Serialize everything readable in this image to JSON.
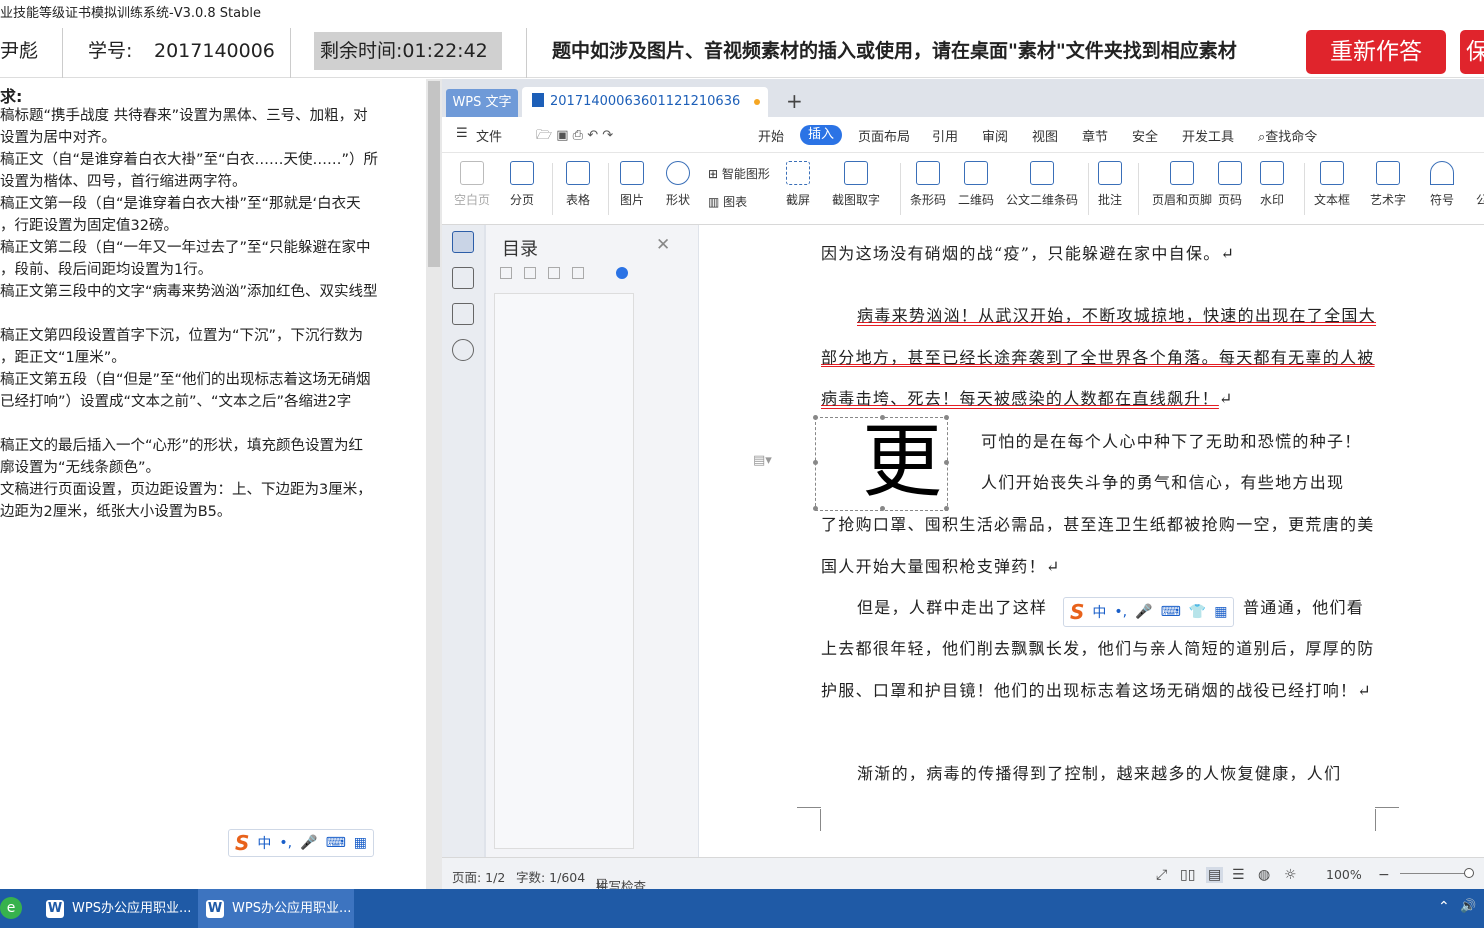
{
  "window": {
    "title": "业技能等级证书模拟训练系统-V3.0.8 Stable"
  },
  "header": {
    "name_fragment": "尹彪",
    "student_id_label": "学号:",
    "student_id": "2017140006",
    "timer_label": "剩余时间:",
    "timer_value": "01:22:42",
    "notice": "题中如涉及图片、音视频素材的插入或使用，请在桌面\"素材\"文件夹找到相应素材",
    "redo_button": "重新作答",
    "save_button_fragment": "保"
  },
  "requirements": {
    "title": "求:",
    "lines": [
      "稿标题“携手战度 共待春来”设置为黑体、三号、加粗，对",
      "设置为居中对齐。",
      "稿正文（自“是谁穿着白衣大褂”至“白衣……天使……”）所",
      "设置为楷体、四号，首行缩进两字符。",
      "稿正文第一段（自“是谁穿着白衣大褂”至“那就是‘白衣天",
      "，行距设置为固定值32磅。",
      "稿正文第二段（自“一年又一年过去了”至“只能躲避在家中",
      "，段前、段后间距均设置为1行。",
      "稿正文第三段中的文字“病毒来势汹汹”添加红色、双实线型",
      "",
      "稿正文第四段设置首字下沉，位置为“下沉”，下沉行数为",
      "，距正文“1厘米”。",
      "稿正文第五段（自“但是”至“他们的出现标志着这场无硝烟",
      "已经打响”）设置成“文本之前”、“文本之后”各缩进2字",
      "",
      "稿正文的最后插入一个“心形”的形状，填充颜色设置为红",
      "廓设置为“无线条颜色”。",
      "文稿进行页面设置，页边距设置为：上、下边距为3厘米，",
      "边距为2厘米，纸张大小设置为B5。"
    ]
  },
  "ime": {
    "zh": "中",
    "punct": "•,"
  },
  "wps": {
    "tab_app": "WPS 文字",
    "tab_doc": "20171400063601121210636",
    "menus": [
      "文件",
      "开始",
      "插入",
      "页面布局",
      "引用",
      "审阅",
      "视图",
      "章节",
      "安全",
      "开发工具",
      "查找命令"
    ],
    "active_menu": "插入",
    "ribbon": [
      {
        "label": "空白页",
        "disabled": true
      },
      {
        "label": "分页"
      },
      {
        "label": "表格"
      },
      {
        "label": "图片"
      },
      {
        "label": "形状"
      },
      {
        "label": "截屏"
      },
      {
        "label": "截图取字"
      },
      {
        "label": "条形码"
      },
      {
        "label": "二维码"
      },
      {
        "label": "公文二维条码"
      },
      {
        "label": "批注"
      },
      {
        "label": "页眉和页脚"
      },
      {
        "label": "页码"
      },
      {
        "label": "水印"
      },
      {
        "label": "文本框"
      },
      {
        "label": "艺术字"
      },
      {
        "label": "符号"
      },
      {
        "label": "公"
      }
    ],
    "ribbon_small": {
      "smart_shape": "智能图形",
      "chart": "图表"
    },
    "toc_title": "目录",
    "document": {
      "p0": "因为这场没有硝烟的战“疫”，只能躲避在家中自保。↵",
      "p1": "病毒来势汹汹！从武汉开始，不断攻城掠地，快速的出现在了全国大部分地方，甚至已经长途奔袭到了全世界各个角落。每天都有无辜的人被病毒击垮、死去！每天被感染的人数都在直线飙升！",
      "p1_end": "↵",
      "dropcap": "更",
      "p2_l1": "可怕的是在每个人心中种下了无助和恐慌的种子！",
      "p2_l2": "人们开始丧失斗争的勇气和信心，有些地方出现",
      "p2_rest": "了抢购口罩、囤积生活必需品，甚至连卫生纸都被抢购一空，更荒唐的美国人开始大量囤积枪支弹药！↵",
      "p3_l1a": "但是，人群中走出了这样",
      "p3_l1b": "普通通，他们看",
      "p3_rest": "上去都很年轻，他们削去飘飘长发，他们与亲人简短的道别后，厚厚的防护服、口罩和护目镜！他们的出现标志着这场无硝烟的战役已经打响！↵",
      "p4": "渐渐的，病毒的传播得到了控制，越来越多的人恢复健康，人们"
    },
    "status": {
      "page": "页面: 1/2",
      "words": "字数: 1/604",
      "spell": "拼写检查",
      "zoom": "100%"
    }
  },
  "taskbar": {
    "items": [
      "WPS办公应用职业...",
      "WPS办公应用职业..."
    ]
  },
  "colors": {
    "accent": "#2b73e5",
    "danger": "#e0242c",
    "taskbar": "#1f5aa6"
  }
}
